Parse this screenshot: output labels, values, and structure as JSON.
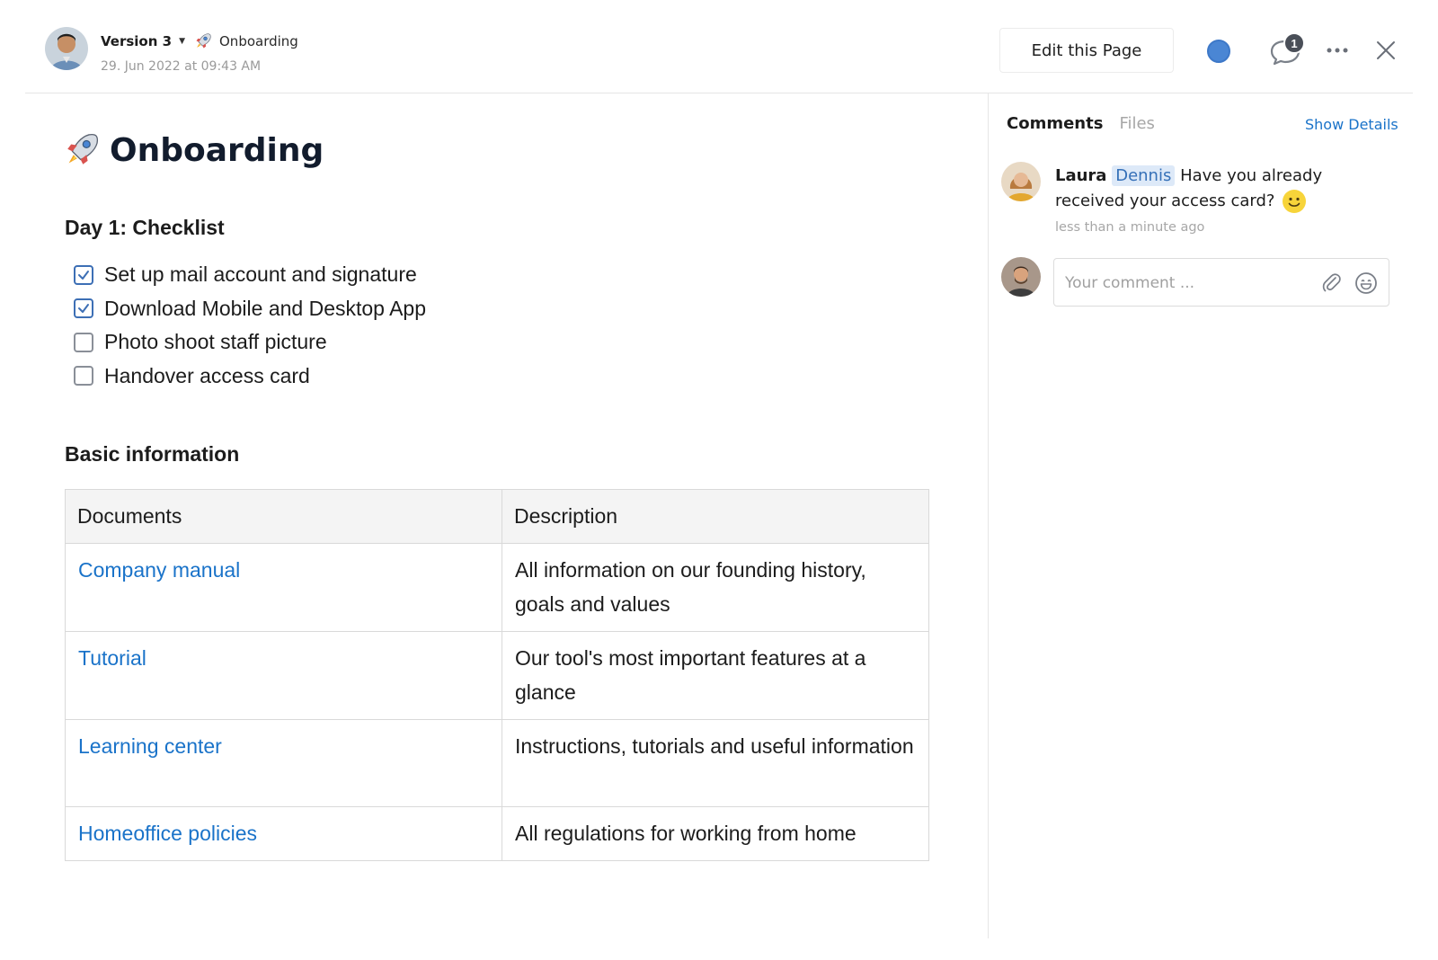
{
  "header": {
    "version_label": "Version 3",
    "page_name": "Onboarding",
    "date": "29. Jun 2022 at 09:43 AM",
    "edit_button": "Edit this Page",
    "comment_count": "1"
  },
  "main": {
    "title": "Onboarding",
    "checklist_heading": "Day 1: Checklist",
    "checklist": [
      {
        "label": "Set up mail account and signature",
        "checked": true
      },
      {
        "label": "Download Mobile and Desktop App",
        "checked": true
      },
      {
        "label": "Photo shoot staff picture",
        "checked": false
      },
      {
        "label": "Handover access card",
        "checked": false
      }
    ],
    "info_heading": "Basic information",
    "table": {
      "headers": [
        "Documents",
        "Description"
      ],
      "rows": [
        {
          "doc": "Company manual",
          "desc": "All information on our founding history, goals and values"
        },
        {
          "doc": "Tutorial",
          "desc": "Our tool's most important features at a glance"
        },
        {
          "doc": "Learning center",
          "desc": "Instructions, tutorials and useful information"
        },
        {
          "doc": "Homeoffice policies",
          "desc": "All regulations for working from home"
        }
      ]
    }
  },
  "sidebar": {
    "tabs": [
      "Comments",
      "Files"
    ],
    "show_details": "Show Details",
    "comment": {
      "author": "Laura",
      "mention": "Dennis",
      "text": "Have you already received your access card?",
      "time": "less than a minute ago"
    },
    "reply_placeholder": "Your comment ..."
  },
  "colors": {
    "link": "#1a73c9",
    "status_dot": "#4a86d4",
    "mention_bg": "#dde9f8",
    "title": "#121c2d"
  },
  "icons": [
    "rocket-icon",
    "caret-down-icon",
    "comment-icon",
    "more-icon",
    "close-icon",
    "checkbox-icon",
    "smile-emoji-icon",
    "paperclip-icon",
    "emoji-icon"
  ]
}
